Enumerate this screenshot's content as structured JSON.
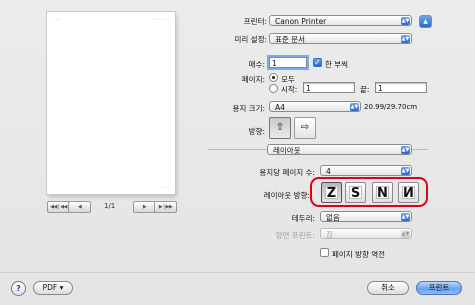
{
  "preview": {
    "header_left": "• • •",
    "header_right": "• • • • • •",
    "footer": "• • •",
    "first_btn": "◀◀ | ◀◀",
    "prev_btn": "◀",
    "page_count": "1/1",
    "next_btn": "▶",
    "last_btn": "▶ | ▶▶"
  },
  "printer": {
    "label": "프린터:",
    "value": "Canon Printer"
  },
  "presets": {
    "label": "미리 설정:",
    "value": "표준 문서"
  },
  "copies": {
    "label": "매수:",
    "value": "1",
    "collate_label": "한 부씩",
    "collate_checked": true
  },
  "pages": {
    "label": "페이지:",
    "all_label": "모두",
    "from_label": "시작:",
    "from_value": "1",
    "to_label": "끝:",
    "to_value": "1",
    "selected": "all"
  },
  "paper_size": {
    "label": "용지 크기:",
    "value": "A4",
    "dimensions": "20.99/29.70cm"
  },
  "orientation": {
    "label": "방향:",
    "selected": "portrait"
  },
  "section_popup": {
    "value": "레이아웃"
  },
  "pages_per_sheet": {
    "label": "용지당 페이지 수:",
    "value": "4"
  },
  "layout_direction": {
    "label": "레이아웃 방향:",
    "options": [
      "Z",
      "S",
      "N",
      "И"
    ],
    "selected_index": 0,
    "highlight_color": "#e0001a"
  },
  "border": {
    "label": "테두리:",
    "value": "없음"
  },
  "two_sided": {
    "label": "양면 프린트:",
    "value": "끔",
    "disabled": true
  },
  "reverse_orientation": {
    "label": "페이지 방향 역전",
    "checked": false
  },
  "footer": {
    "help_icon": "?",
    "pdf_label": "PDF ▾",
    "cancel_label": "취소",
    "print_label": "프린트"
  },
  "colors": {
    "accent": "#2a66c9",
    "default_button": "#6ba2ec"
  }
}
